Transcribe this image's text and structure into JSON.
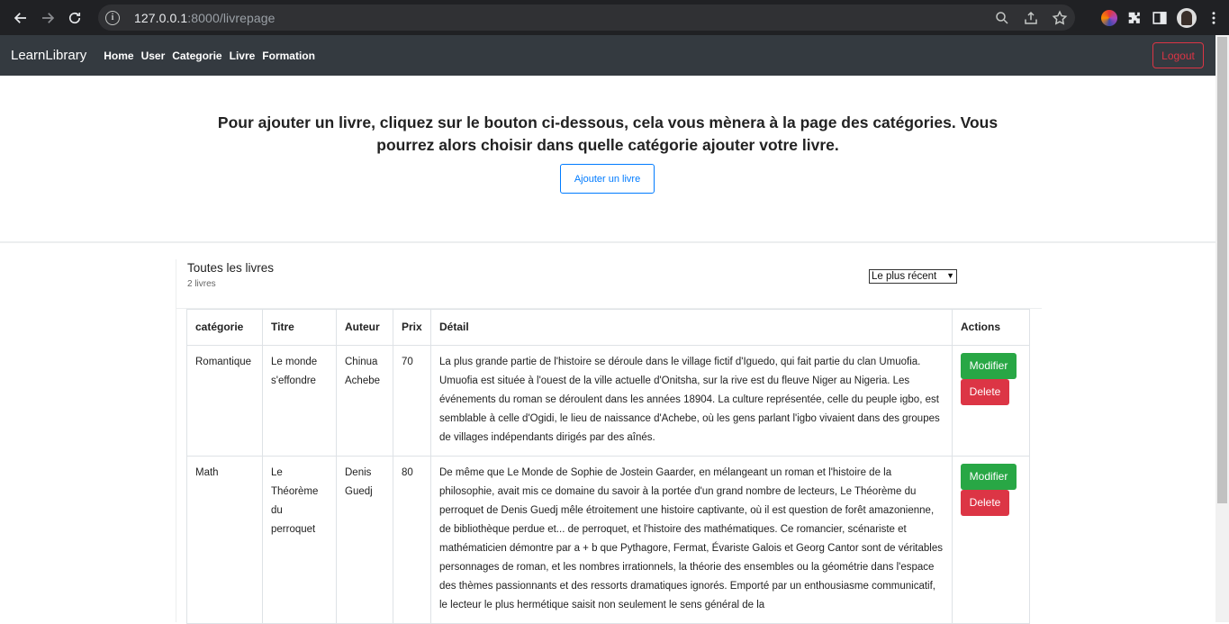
{
  "browser": {
    "url_host": "127.0.0.1",
    "url_rest": ":8000/livrepage"
  },
  "navbar": {
    "brand": "LearnLibrary",
    "links": [
      "Home",
      "User",
      "Categorie",
      "Livre",
      "Formation"
    ],
    "logout": "Logout"
  },
  "hero": {
    "text": "Pour ajouter un livre, cliquez sur le bouton ci-dessous, cela vous mènera à la page des catégories. Vous pourrez alors choisir dans quelle catégorie ajouter votre livre.",
    "button": "Ajouter un livre"
  },
  "list": {
    "title": "Toutes les livres",
    "count": "2 livres",
    "sort": "Le plus récent"
  },
  "table": {
    "headers": [
      "catégorie",
      "Titre",
      "Auteur",
      "Prix",
      "Détail",
      "Actions"
    ],
    "rows": [
      {
        "categorie": "Romantique",
        "titre": "Le monde s'effondre",
        "auteur": "Chinua Achebe",
        "prix": "70",
        "detail": "La plus grande partie de l'histoire se déroule dans le village fictif d'Iguedo, qui fait partie du clan Umuofia. Umuofia est située à l'ouest de la ville actuelle d'Onitsha, sur la rive est du fleuve Niger au Nigeria. Les événements du roman se déroulent dans les années 18904. La culture représentée, celle du peuple igbo, est semblable à celle d'Ogidi, le lieu de naissance d'Achebe, où les gens parlant l'igbo vivaient dans des groupes de villages indépendants dirigés par des aînés.",
        "modifier": "Modifier",
        "delete": "Delete"
      },
      {
        "categorie": "Math",
        "titre": "Le Théorème du perroquet",
        "auteur": "Denis Guedj",
        "prix": "80",
        "detail": "De même que Le Monde de Sophie de Jostein Gaarder, en mélangeant un roman et l'histoire de la philosophie, avait mis ce domaine du savoir à la portée d'un grand nombre de lecteurs, Le Théorème du perroquet de Denis Guedj mêle étroitement une histoire captivante, où il est question de forêt amazonienne, de bibliothèque perdue et... de perroquet, et l'histoire des mathématiques. Ce romancier, scénariste et mathématicien démontre par a + b que Pythagore, Fermat, Évariste Galois et Georg Cantor sont de véritables personnages de roman, et les nombres irrationnels, la théorie des ensembles ou la géométrie dans l'espace des thèmes passionnants et des ressorts dramatiques ignorés. Emporté par un enthousiasme communicatif, le lecteur le plus hermétique saisit non seulement le sens général de la",
        "modifier": "Modifier",
        "delete": "Delete"
      }
    ]
  }
}
